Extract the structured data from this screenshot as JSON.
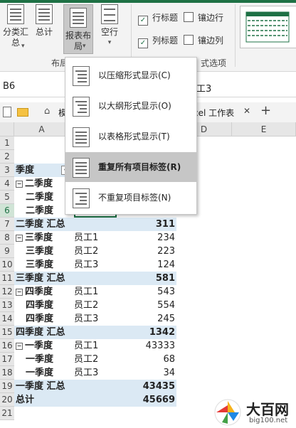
{
  "ribbon": {
    "btn_subtotal": "分类汇\n总",
    "subtotal_line1": "分类汇",
    "subtotal_line2": "总",
    "btn_grandtotal": "总计",
    "report_line1": "报表布",
    "report_line2": "局",
    "blank_rows": "空行",
    "chk_row_headers": "行标题",
    "chk_banded_rows": "镶边行",
    "chk_col_headers": "列标题",
    "chk_banded_cols": "镶边列",
    "group_layout_partial": "布局",
    "group_options_partial": "式选项",
    "row_headers_checked": true,
    "col_headers_checked": true
  },
  "formula_bar": {
    "name_box": "B6",
    "formula_partial": "工3"
  },
  "tabs": {
    "home_partial": "模",
    "doc_tab_partial": "cel 工作表",
    "close": "✕",
    "add": "+"
  },
  "columns": [
    "A",
    "D",
    "E"
  ],
  "dropdown": {
    "items": [
      {
        "label": "以压缩形式显示(C)",
        "active": false
      },
      {
        "label": "以大纲形式显示(O)",
        "active": false
      },
      {
        "label": "以表格形式显示(T)",
        "active": false
      },
      {
        "label": "重复所有项目标签(R)",
        "active": true
      },
      {
        "label": "不重复项目标签(N)",
        "active": false
      }
    ]
  },
  "rows": [
    {
      "n": "1",
      "a": "",
      "b": "",
      "c": ""
    },
    {
      "n": "2",
      "a": "",
      "b": "",
      "c": ""
    },
    {
      "n": "3",
      "a": "季度",
      "b": "",
      "c": "",
      "header": true
    },
    {
      "n": "4",
      "a": "二季度",
      "b": "",
      "c": "",
      "group": true
    },
    {
      "n": "5",
      "a": "二季度",
      "b": "",
      "c": "",
      "indent": true
    },
    {
      "n": "6",
      "a": "二季度",
      "b": "员工3",
      "c": "",
      "indent": true,
      "selected": true
    },
    {
      "n": "7",
      "a": "二季度 汇总",
      "b": "",
      "c": "311",
      "total": true
    },
    {
      "n": "8",
      "a": "三季度",
      "b": "员工1",
      "c": "234",
      "group": true
    },
    {
      "n": "9",
      "a": "三季度",
      "b": "员工2",
      "c": "223",
      "indent": true
    },
    {
      "n": "10",
      "a": "三季度",
      "b": "员工3",
      "c": "124",
      "indent": true
    },
    {
      "n": "11",
      "a": "三季度 汇总",
      "b": "",
      "c": "581",
      "total": true
    },
    {
      "n": "12",
      "a": "四季度",
      "b": "员工1",
      "c": "543",
      "group": true
    },
    {
      "n": "13",
      "a": "四季度",
      "b": "员工2",
      "c": "554",
      "indent": true
    },
    {
      "n": "14",
      "a": "四季度",
      "b": "员工3",
      "c": "245",
      "indent": true
    },
    {
      "n": "15",
      "a": "四季度 汇总",
      "b": "",
      "c": "1342",
      "total": true
    },
    {
      "n": "16",
      "a": "一季度",
      "b": "员工1",
      "c": "43333",
      "group": true
    },
    {
      "n": "17",
      "a": "一季度",
      "b": "员工2",
      "c": "68",
      "indent": true
    },
    {
      "n": "18",
      "a": "一季度",
      "b": "员工3",
      "c": "34",
      "indent": true
    },
    {
      "n": "19",
      "a": "一季度 汇总",
      "b": "",
      "c": "43435",
      "total": true
    },
    {
      "n": "20",
      "a": "总计",
      "b": "",
      "c": "45669",
      "grand": true
    },
    {
      "n": "21",
      "a": "",
      "b": "",
      "c": ""
    }
  ],
  "watermark": {
    "title": "大百网",
    "url": "big100.net"
  },
  "colors": {
    "accent": "#1e7145",
    "dropdown_active": "#c6c6c6",
    "total_row": "#dbe9f4"
  }
}
